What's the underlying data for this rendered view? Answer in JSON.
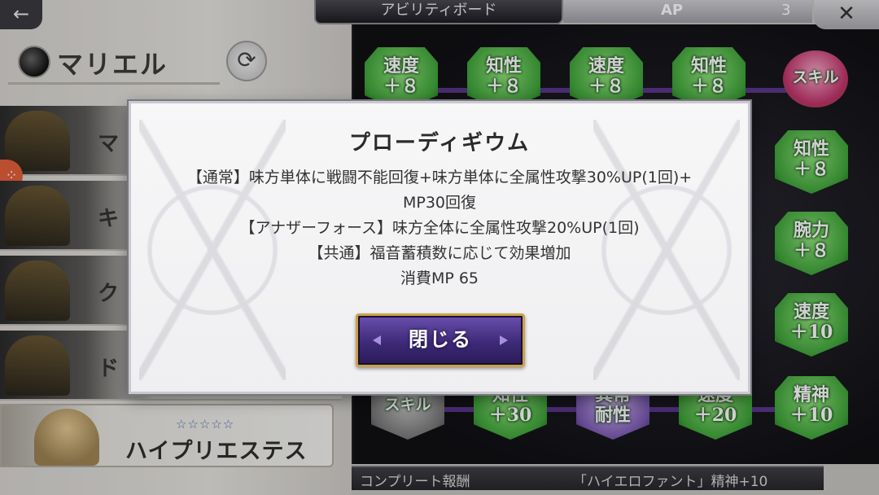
{
  "header": {
    "back_icon": "←",
    "board_title": "アビリティボード",
    "ap_label": "AP",
    "ap_value": "3",
    "close_icon": "✕"
  },
  "character": {
    "name": "マリエル",
    "refresh_icon": "⟳"
  },
  "job_list": [
    {
      "label": "マ"
    },
    {
      "label": "キ"
    },
    {
      "label": "ク"
    },
    {
      "label": "ド"
    }
  ],
  "selected_job": {
    "stars": "☆☆☆☆☆",
    "name": "ハイプリエステス"
  },
  "board_nodes": [
    {
      "stat": "速度",
      "value": "＋８",
      "color": "green"
    },
    {
      "stat": "知性",
      "value": "＋８",
      "color": "green"
    },
    {
      "stat": "速度",
      "value": "＋８",
      "color": "green"
    },
    {
      "stat": "知性",
      "value": "＋８",
      "color": "green"
    },
    {
      "stat": "スキル",
      "value": "",
      "color": "gold"
    },
    {
      "stat": "知性",
      "value": "＋８",
      "color": "green"
    },
    {
      "stat": "腕力",
      "value": "＋８",
      "color": "green"
    },
    {
      "stat": "速度",
      "value": "＋10",
      "color": "green"
    },
    {
      "stat": "スキル",
      "value": "",
      "color": "gray"
    },
    {
      "stat": "知性",
      "value": "＋30",
      "color": "green"
    },
    {
      "stat": "異常",
      "value": "耐性",
      "color": "purple"
    },
    {
      "stat": "速度",
      "value": "＋20",
      "color": "green"
    },
    {
      "stat": "精神",
      "value": "＋10",
      "color": "green"
    }
  ],
  "footer": {
    "complete_label": "コンプリート報酬",
    "complete_reward": "「ハイエロファント」精神+10"
  },
  "modal": {
    "title": "プローディギウム",
    "lines": [
      "【通常】味方単体に戦闘不能回復+味方単体に全属性攻撃30%UP(1回)+",
      "MP30回復",
      "【アナザーフォース】味方全体に全属性攻撃20%UP(1回)",
      "【共通】福音蓄積数に応じて効果増加",
      "消費MP 65"
    ],
    "close_label": "閉じる"
  },
  "colors": {
    "node_green": "#3fa43a",
    "modal_bg": "#f5f5f6",
    "button_purple": "#3d2a78",
    "button_border_gold": "#c9a24a"
  }
}
